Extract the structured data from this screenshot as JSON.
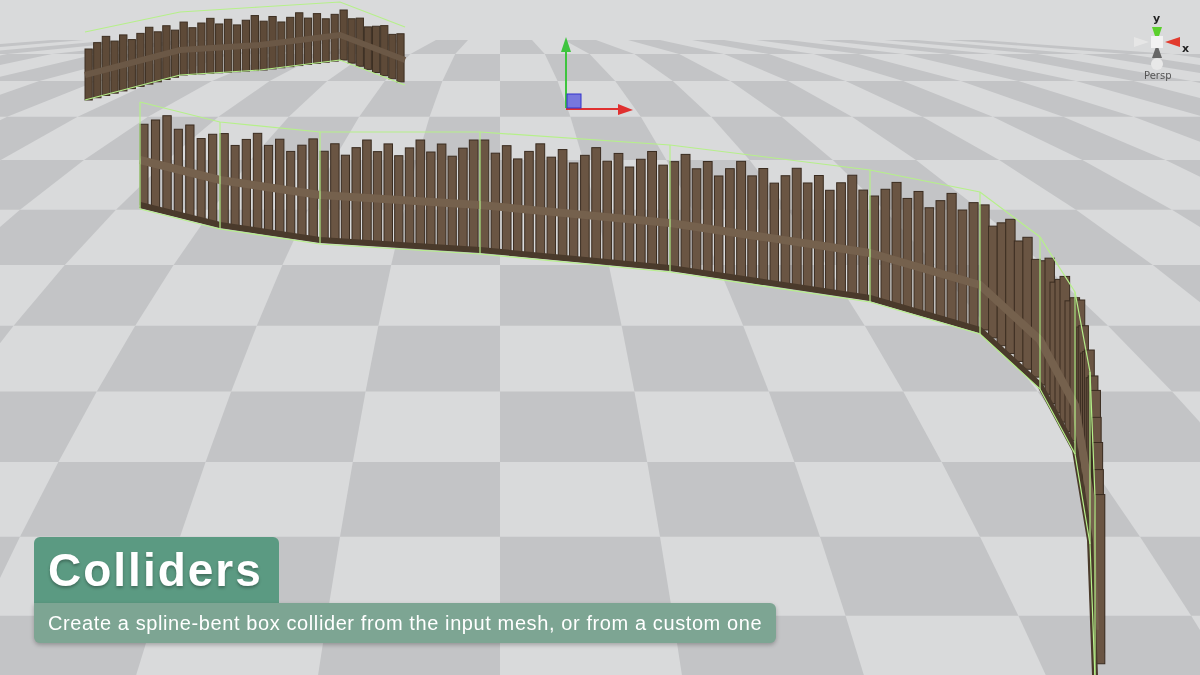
{
  "scene_view": {
    "orientation_gizmo": {
      "y_axis_label": "y",
      "x_axis_label": "x",
      "projection_label": "Persp"
    }
  },
  "caption": {
    "title": "Colliders",
    "subtitle": "Create a spline-bent box collider from the input mesh, or from a custom one"
  }
}
